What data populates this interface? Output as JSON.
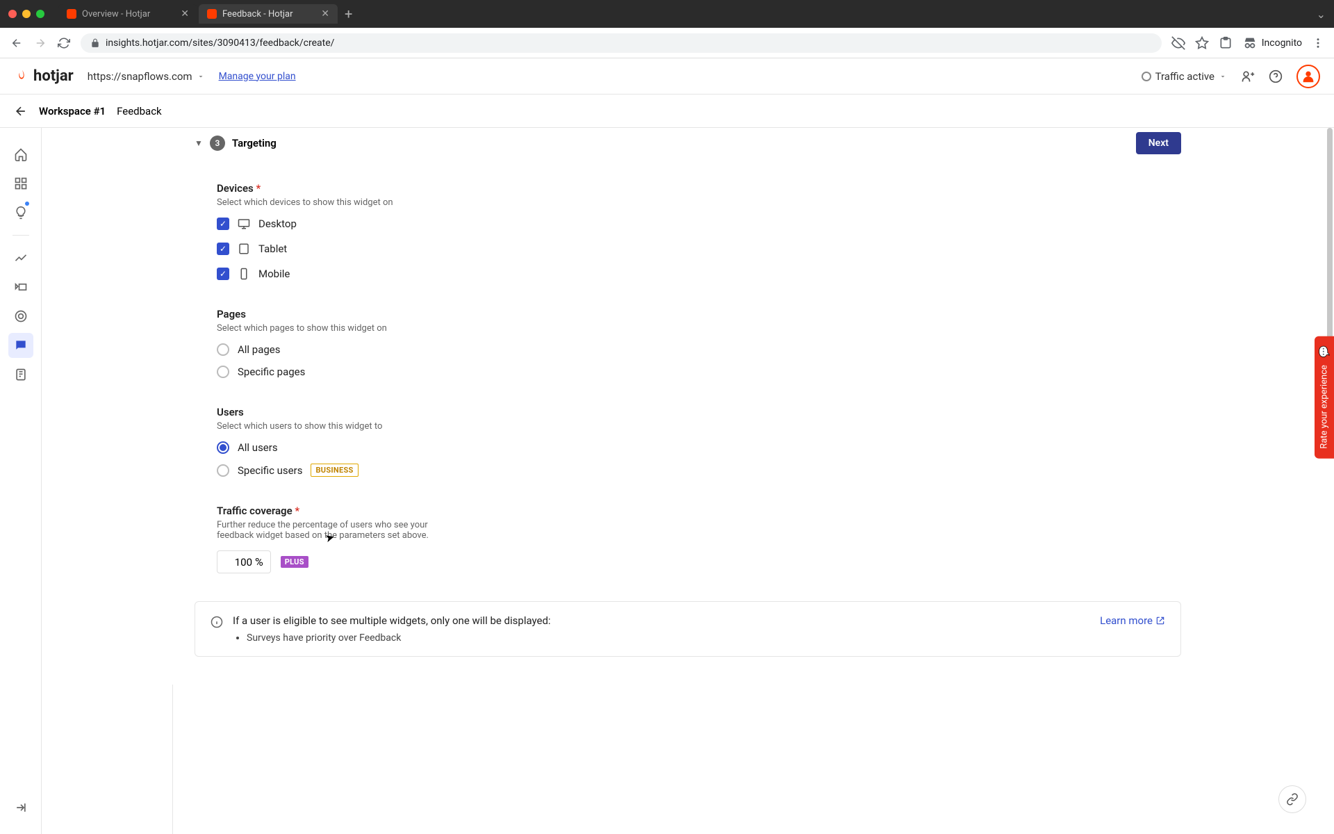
{
  "browser": {
    "tabs": [
      {
        "title": "Overview - Hotjar"
      },
      {
        "title": "Feedback - Hotjar"
      }
    ],
    "url": "insights.hotjar.com/sites/3090413/feedback/create/",
    "incognito_label": "Incognito"
  },
  "header": {
    "logo": "hotjar",
    "site": "https://snapflows.com",
    "manage_plan": "Manage your plan",
    "traffic_status": "Traffic active"
  },
  "breadcrumb": {
    "workspace": "Workspace #1",
    "page": "Feedback"
  },
  "section": {
    "step": "3",
    "title": "Targeting",
    "next": "Next"
  },
  "devices": {
    "title": "Devices",
    "subtitle": "Select which devices to show this widget on",
    "options": {
      "desktop": "Desktop",
      "tablet": "Tablet",
      "mobile": "Mobile"
    }
  },
  "pages": {
    "title": "Pages",
    "subtitle": "Select which pages to show this widget on",
    "options": {
      "all": "All pages",
      "specific": "Specific pages"
    }
  },
  "users": {
    "title": "Users",
    "subtitle": "Select which users to show this widget to",
    "options": {
      "all": "All users",
      "specific": "Specific users"
    },
    "badge": "BUSINESS"
  },
  "traffic": {
    "title": "Traffic coverage",
    "subtitle": "Further reduce the percentage of users who see your feedback widget based on the parameters set above.",
    "value": "100",
    "unit": "%",
    "badge": "PLUS"
  },
  "info": {
    "heading": "If a user is eligible to see multiple widgets, only one will be displayed:",
    "bullet1": "Surveys have priority over Feedback",
    "learn_more": "Learn more"
  },
  "rate_tab": "Rate your experience"
}
